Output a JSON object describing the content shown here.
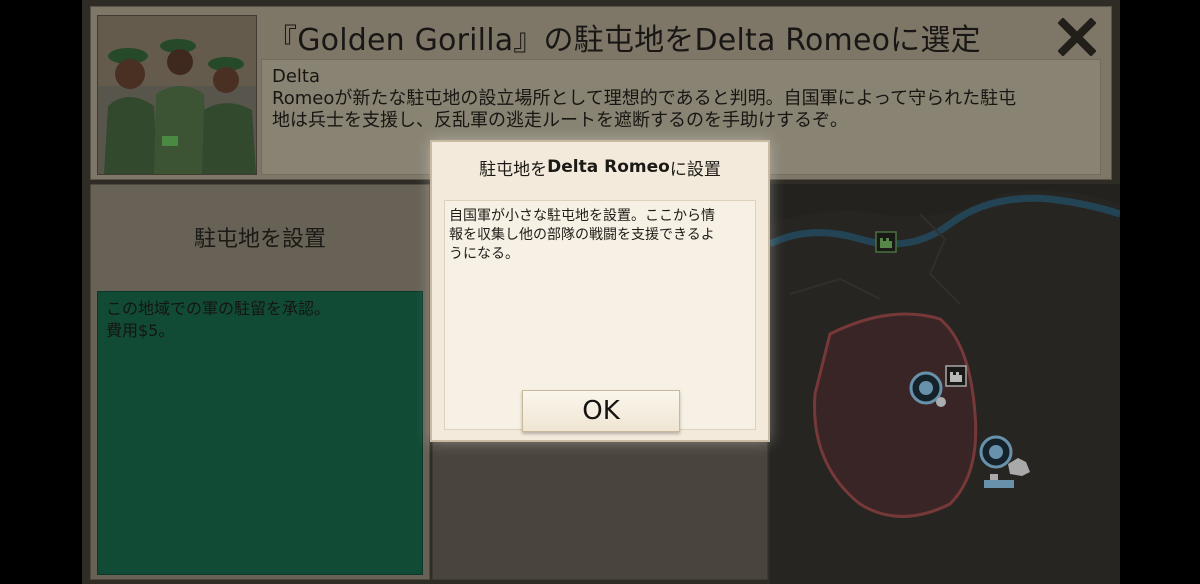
{
  "event": {
    "title": "『Golden Gorilla』の駐屯地をDelta Romeoに選定",
    "description_lines": [
      "Delta",
      "Romeoが新たな駐屯地の設立場所として理想的であると判明。自国軍によって守られた駐屯",
      "地は兵士を支援し、反乱軍の逃走ルートを遮断するのを手助けするぞ。"
    ]
  },
  "action": {
    "header": "駐屯地を設置",
    "description_lines": [
      "この地域での軍の駐留を承認。",
      "費用$5。"
    ]
  },
  "modal": {
    "title_prefix": "駐屯地を",
    "title_bold": "Delta Romeo",
    "title_suffix": "に設置",
    "body_lines": [
      "自国軍が小さな駐屯地を設置。ここから情",
      "報を収集し他の部隊の戦闘を支援できるよ",
      "うになる。"
    ],
    "ok_label": "OK"
  },
  "icons": {
    "close": "close-x-icon",
    "fort": "fort-icon",
    "unit": "unit-marker-icon"
  },
  "colors": {
    "action_green": "#155c43",
    "river_blue": "#2a5a73",
    "zone_red": "#a14a4a",
    "unit_blue": "#7fb3d1"
  }
}
